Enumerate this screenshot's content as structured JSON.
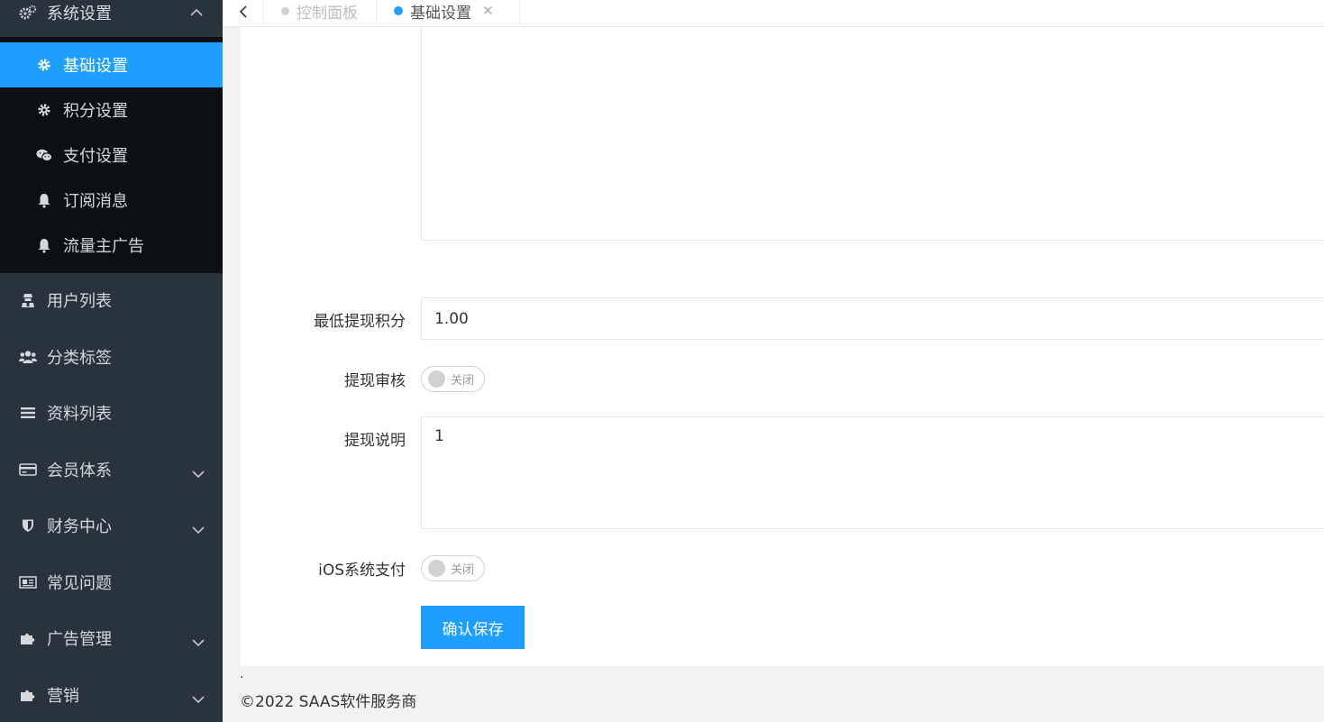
{
  "sidebar": {
    "group_title": "系统设置",
    "sub_items": [
      {
        "label": "基础设置",
        "icon": "gear-icon",
        "active": true
      },
      {
        "label": "积分设置",
        "icon": "gear-icon"
      },
      {
        "label": "支付设置",
        "icon": "wechat-icon"
      },
      {
        "label": "订阅消息",
        "icon": "bell-icon"
      },
      {
        "label": "流量主广告",
        "icon": "bell-icon"
      }
    ],
    "items": [
      {
        "label": "用户列表",
        "icon": "user-secret-icon"
      },
      {
        "label": "分类标签",
        "icon": "users-icon"
      },
      {
        "label": "资料列表",
        "icon": "list-icon"
      },
      {
        "label": "会员体系",
        "icon": "credit-card-icon",
        "has_children": true
      },
      {
        "label": "财务中心",
        "icon": "shield-icon",
        "has_children": true
      },
      {
        "label": "常见问题",
        "icon": "newspaper-icon"
      },
      {
        "label": "广告管理",
        "icon": "puzzle-icon",
        "has_children": true
      },
      {
        "label": "营销",
        "icon": "puzzle-icon",
        "has_children": true
      }
    ]
  },
  "tabs": [
    {
      "label": "控制面板"
    },
    {
      "label": "基础设置",
      "active": true
    }
  ],
  "form": {
    "min_withdraw_label": "最低提现积分",
    "min_withdraw_value": "1.00",
    "withdraw_review_label": "提现审核",
    "withdraw_review_state": "关闭",
    "withdraw_desc_label": "提现说明",
    "withdraw_desc_value": "1",
    "ios_pay_label": "iOS系统支付",
    "ios_pay_state": "关闭",
    "save_label": "确认保存"
  },
  "footer": {
    "dot": ".",
    "copyright": "©2022 SAAS软件服务商"
  },
  "colors": {
    "accent": "#1e9fff",
    "sidebar_bg": "#28333e",
    "submenu_bg": "#0c1014"
  }
}
